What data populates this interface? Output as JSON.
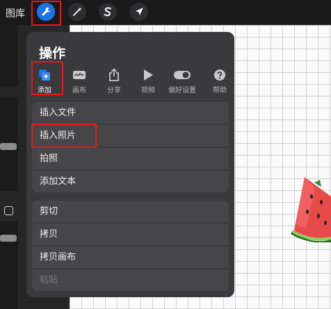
{
  "topbar": {
    "gallery_label": "图库",
    "tools": [
      {
        "icon": "wrench-icon",
        "active": true
      },
      {
        "icon": "magic-wand-icon",
        "active": false
      },
      {
        "icon": "selection-s-icon",
        "active": false
      },
      {
        "icon": "arrow-cursor-icon",
        "active": false
      }
    ]
  },
  "panel": {
    "title": "操作",
    "tabs": [
      {
        "label": "添加",
        "icon": "add-copy-icon",
        "active": true
      },
      {
        "label": "画布",
        "icon": "canvas-icon"
      },
      {
        "label": "分享",
        "icon": "share-icon"
      },
      {
        "label": "视频",
        "icon": "play-icon"
      },
      {
        "label": "偏好设置",
        "icon": "toggle-icon"
      },
      {
        "label": "帮助",
        "icon": "help-icon"
      }
    ],
    "group1": [
      "插入文件",
      "插入照片",
      "拍照",
      "添加文本"
    ],
    "group2": [
      "剪切",
      "拷贝",
      "拷贝画布",
      "粘贴"
    ]
  },
  "colors": {
    "accent": "#1a73e8",
    "highlight": "#e8171c",
    "panel": "#3a3a3c"
  }
}
